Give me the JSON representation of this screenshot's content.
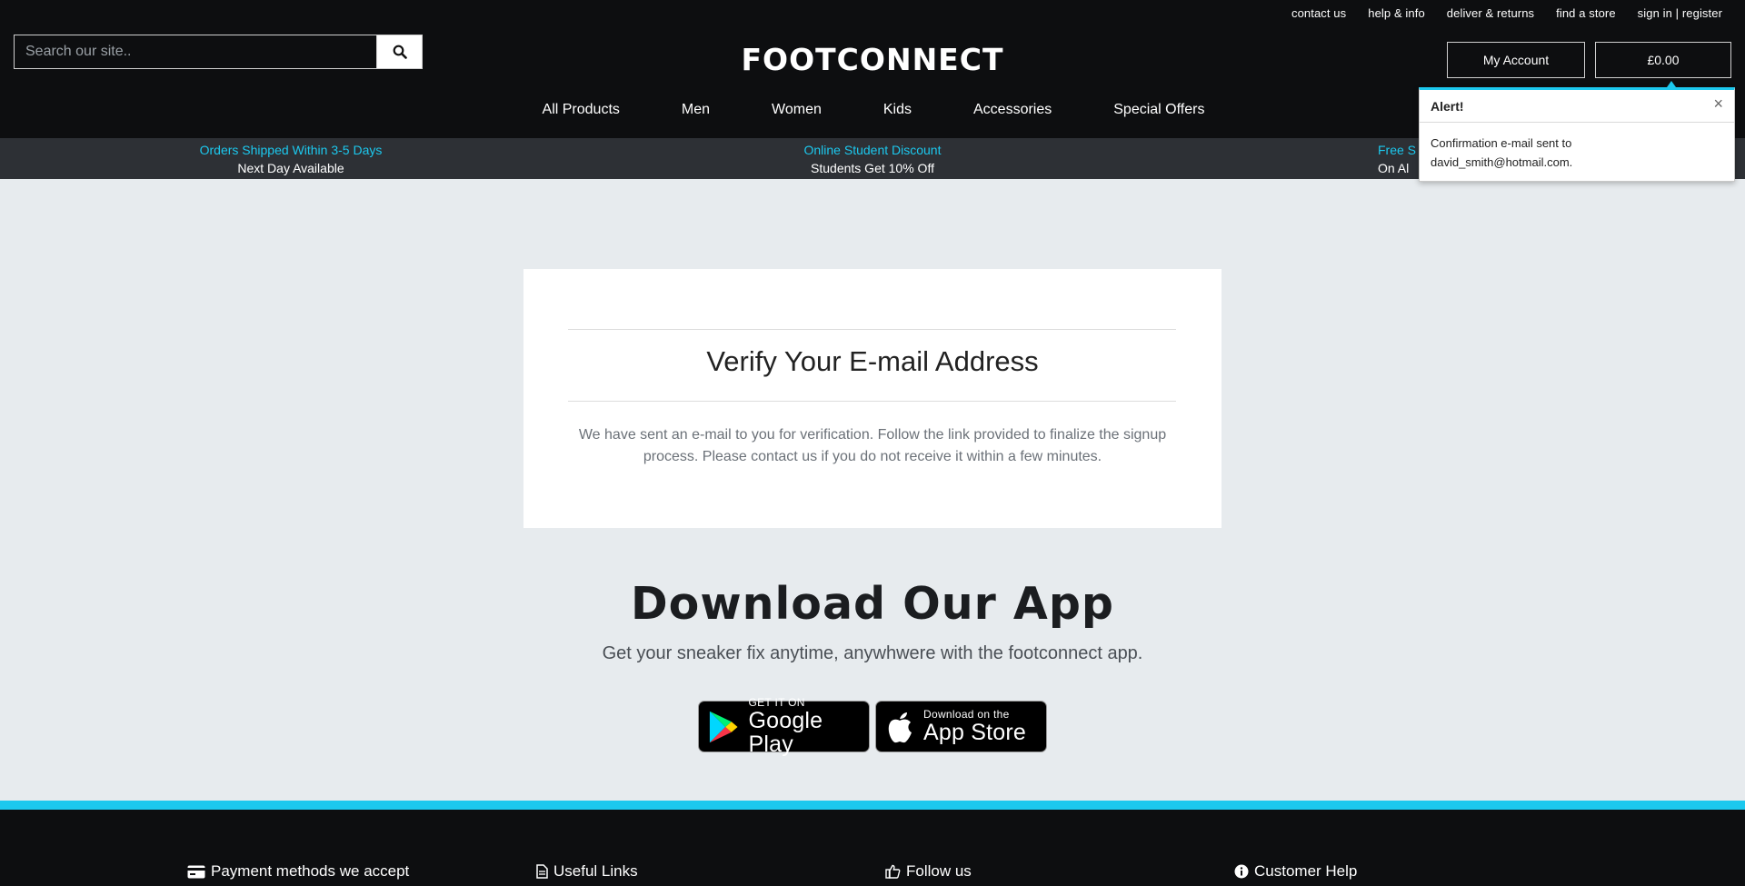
{
  "top_links": [
    "contact us",
    "help & info",
    "deliver & returns",
    "find a store",
    "sign in | register"
  ],
  "search": {
    "placeholder": "Search our site.."
  },
  "logo": "FOOTCONNECT",
  "account": {
    "my_account_label": "My Account",
    "cart_total": "£0.00"
  },
  "nav": [
    "All Products",
    "Men",
    "Women",
    "Kids",
    "Accessories",
    "Special Offers"
  ],
  "promo": [
    {
      "title": "Orders Shipped Within 3-5 Days",
      "subtitle": "Next Day Available"
    },
    {
      "title": "Online Student Discount",
      "subtitle": "Students Get 10% Off"
    },
    {
      "title": "Free S",
      "subtitle": "On Al"
    }
  ],
  "alert": {
    "title": "Alert!",
    "close": "×",
    "message_line1": "Confirmation e-mail sent to",
    "message_line2": "david_smith@hotmail.com."
  },
  "verify": {
    "heading": "Verify Your E-mail Address",
    "body": "We have sent an e-mail to you for verification. Follow the link provided to finalize the signup process. Please contact us if you do not receive it within a few minutes."
  },
  "app": {
    "title": "Download Our App",
    "subtitle": "Get your sneaker fix anytime, anywhwere with the footconnect app.",
    "google": {
      "small": "GET IT ON",
      "big": "Google Play"
    },
    "apple": {
      "small": "Download on the",
      "big": "App Store"
    }
  },
  "footer": {
    "columns": [
      "Payment methods we accept",
      "Useful Links",
      "Follow us",
      "Customer Help"
    ]
  },
  "colors": {
    "accent": "#1cc8ee",
    "header_bg": "#0d0e10",
    "promo_bg": "#2d3035",
    "page_bg": "#e7ebee"
  }
}
